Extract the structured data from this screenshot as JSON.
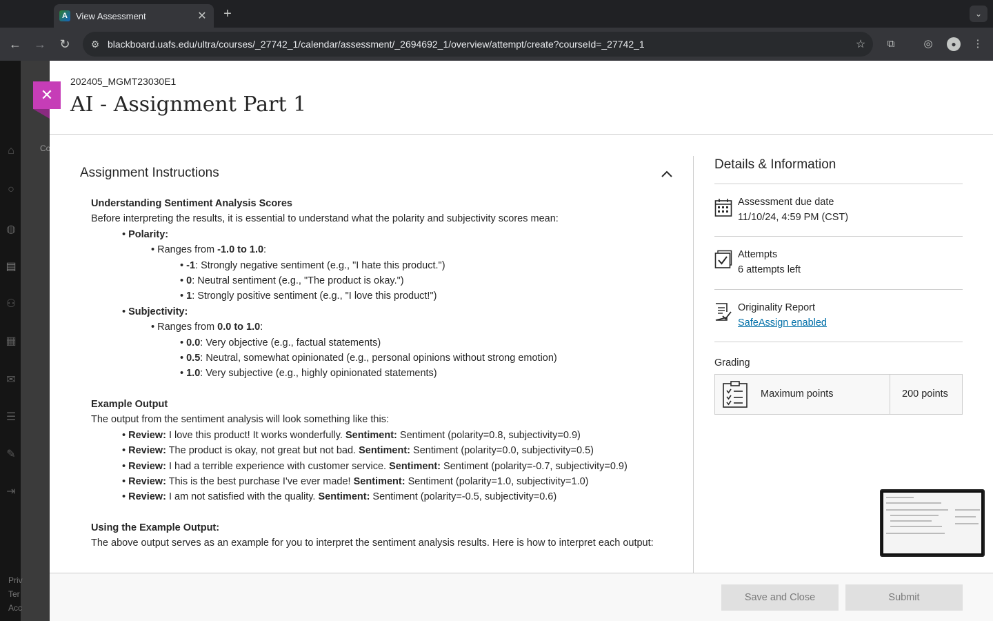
{
  "browser": {
    "tab_title": "View Assessment",
    "tab_favicon_letter": "A",
    "url": "blackboard.uafs.edu/ultra/courses/_27742_1/calendar/assessment/_2694692_1/overview/attempt/create?courseId=_27742_1"
  },
  "background": {
    "fragment_co": "Co",
    "footer_fragments": [
      "Priv",
      "Ter",
      "Acc"
    ]
  },
  "header": {
    "course_id": "202405_MGMT23030E1",
    "title": "AI - Assignment Part 1"
  },
  "instructions": {
    "heading": "Assignment Instructions",
    "section1_title": "Understanding Sentiment Analysis Scores",
    "section1_intro": "Before interpreting the results, it is essential to understand what the polarity and subjectivity scores mean:",
    "polarity_label": "Polarity:",
    "polarity_range_prefix": "Ranges from ",
    "polarity_range": "-1.0 to 1.0",
    "polarity_items": [
      {
        "key": "-1",
        "text": ": Strongly negative sentiment (e.g., \"I hate this product.\")"
      },
      {
        "key": "0",
        "text": ": Neutral sentiment (e.g., \"The product is okay.\")"
      },
      {
        "key": "1",
        "text": ": Strongly positive sentiment (e.g., \"I love this product!\")"
      }
    ],
    "subjectivity_label": "Subjectivity:",
    "subjectivity_range_prefix": "Ranges from ",
    "subjectivity_range": "0.0 to 1.0",
    "subjectivity_items": [
      {
        "key": "0.0",
        "text": ": Very objective (e.g., factual statements)"
      },
      {
        "key": "0.5",
        "text": ": Neutral, somewhat opinionated (e.g., personal opinions without strong emotion)"
      },
      {
        "key": "1.0",
        "text": ": Very subjective (e.g., highly opinionated statements)"
      }
    ],
    "section2_title": "Example Output",
    "section2_intro": "The output from the sentiment analysis will look something like this:",
    "review_label": "Review:",
    "sentiment_label": "Sentiment:",
    "reviews": [
      {
        "review": " I love this product! It works wonderfully. ",
        "sentiment": " Sentiment (polarity=0.8, subjectivity=0.9)"
      },
      {
        "review": " The product is okay, not great but not bad. ",
        "sentiment": " Sentiment (polarity=0.0, subjectivity=0.5)"
      },
      {
        "review": " I had a terrible experience with customer service. ",
        "sentiment": " Sentiment (polarity=-0.7, subjectivity=0.9)"
      },
      {
        "review": " This is the best purchase I've ever made! ",
        "sentiment": " Sentiment (polarity=1.0, subjectivity=1.0)"
      },
      {
        "review": " I am not satisfied with the quality. ",
        "sentiment": " Sentiment (polarity=-0.5, subjectivity=0.6)"
      }
    ],
    "section3_title": "Using the Example Output:",
    "section3_intro": "The above output serves as an example for you to interpret the sentiment analysis results. Here is how to interpret each output:"
  },
  "details": {
    "title": "Details & Information",
    "due_label": "Assessment due date",
    "due_value": "11/10/24, 4:59 PM (CST)",
    "attempts_label": "Attempts",
    "attempts_value": "6 attempts left",
    "originality_label": "Originality Report",
    "originality_link": "SafeAssign enabled",
    "grading_label": "Grading",
    "grading_name": "Maximum points",
    "grading_points": "200 points"
  },
  "footer": {
    "save_label": "Save and Close",
    "submit_label": "Submit"
  },
  "colors": {
    "accent": "#c63db7",
    "link": "#006fa8"
  }
}
